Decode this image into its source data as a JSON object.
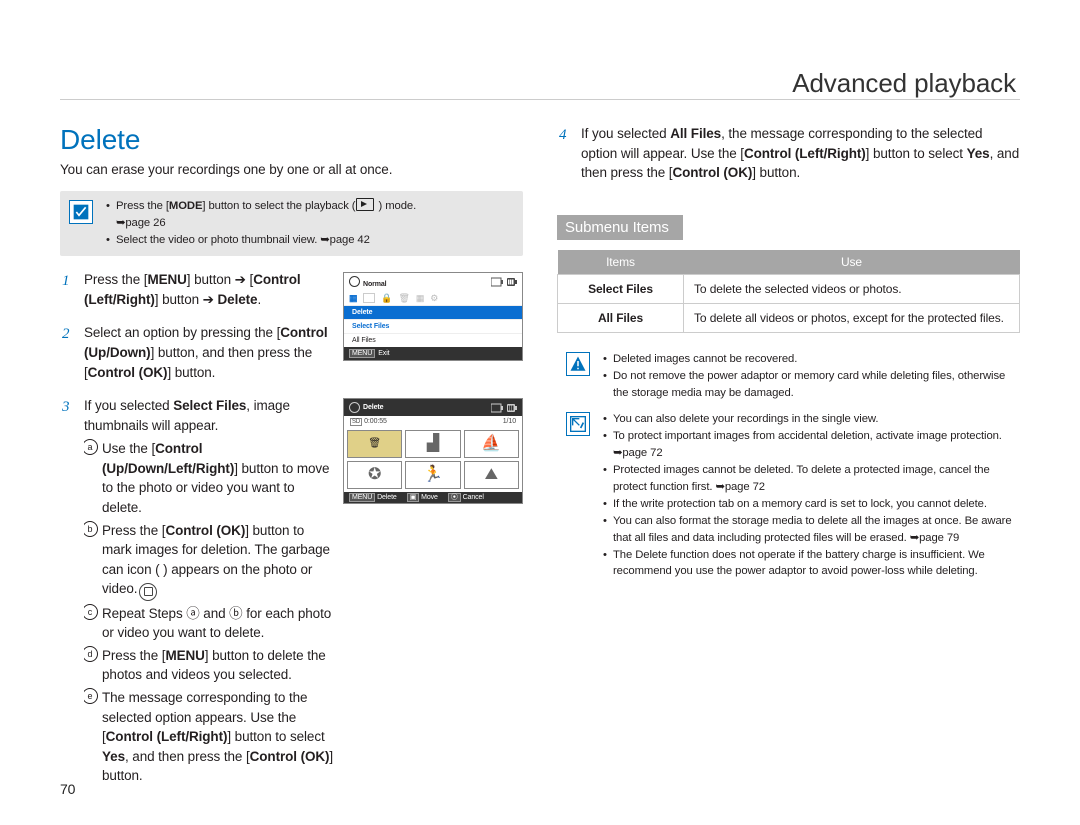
{
  "pageNumber": "70",
  "header": {
    "title": "Advanced playback"
  },
  "section": {
    "heading": "Delete",
    "intro": "You can erase your recordings one by one or all at once."
  },
  "modeBox": {
    "line1a": "Press the [",
    "line1b": "MODE",
    "line1c": "] button to select the playback (",
    "line1d": " ) mode. ",
    "line1ref": "➥page 26",
    "line2": "Select the video or photo thumbnail view. ➥page 42"
  },
  "steps": [
    {
      "parts": [
        "Press the [",
        "MENU",
        "] button ➔ [",
        "Control (Left/Right)",
        "] button ➔ ",
        "Delete",
        "."
      ]
    },
    {
      "parts": [
        "Select an option by pressing the [",
        "Control (Up/Down)",
        "] button, and then press the [",
        "Control (OK)",
        "] button."
      ]
    },
    {
      "parts": [
        "If you selected ",
        "Select Files",
        ", image thumbnails will appear."
      ],
      "sub": [
        {
          "parts": [
            "Use the [",
            "Control (Up/Down/Left/Right)",
            "] button to move to the photo or video you want to delete."
          ]
        },
        {
          "parts": [
            "Press the [",
            "Control (OK)",
            "] button to mark images for deletion. The garbage can icon (   ) appears on the photo or video."
          ]
        },
        {
          "parts": [
            "Repeat Steps ⓐ and ⓑ for each photo or video you want to delete."
          ]
        },
        {
          "parts": [
            "Press the [",
            "MENU",
            "] button to delete the photos and videos you selected."
          ]
        },
        {
          "parts": [
            "The message corresponding to the selected option appears. Use the [",
            "Control (Left/Right)",
            "] button to select ",
            "Yes",
            ", and then press the [",
            "Control (OK)",
            "] button."
          ]
        }
      ]
    },
    {
      "parts": [
        "If you selected ",
        "All Files",
        ", the message corresponding to the selected option will appear. Use the [",
        "Control (Left/Right)",
        "] button to select ",
        "Yes",
        ", and then press the [",
        "Control (OK)",
        "] button."
      ]
    }
  ],
  "figure1": {
    "topLabel": "Normal",
    "menuLabel1": "Delete",
    "menuItems": [
      "Select Files",
      "All Files"
    ],
    "footerBtn": "MENU",
    "footerLabel": "Exit"
  },
  "figure2": {
    "topLabel": "Delete",
    "time": "0:00:55",
    "count": "1/10",
    "footer": [
      {
        "btn": "MENU",
        "label": "Delete"
      },
      {
        "btn": "▣",
        "label": "Move"
      },
      {
        "btn": "⦿",
        "label": "Cancel"
      }
    ]
  },
  "submenu": {
    "heading": "Submenu Items",
    "headers": {
      "col1": "Items",
      "col2": "Use"
    },
    "rows": [
      {
        "name": "Select Files",
        "desc": "To delete the selected videos or photos."
      },
      {
        "name": "All Files",
        "desc": "To delete all videos or photos, except for the protected files."
      }
    ]
  },
  "warnBox": [
    "Deleted images cannot be recovered.",
    "Do not remove the power adaptor or memory card while deleting files, otherwise the storage media may be damaged."
  ],
  "noteBox": [
    "You can also delete your recordings in the single view.",
    "To protect important images from accidental deletion, activate image protection. ➥page 72",
    "Protected images cannot be deleted. To delete a protected image, cancel the protect function first. ➥page 72",
    "If the write protection tab on a memory card is set to lock, you cannot delete.",
    "You can also format the storage media to delete all the images at once. Be aware that all files and data including protected files will be erased. ➥page 79",
    "The Delete function does not operate if the battery charge is insufficient. We recommend you use the power adaptor to avoid power-loss while deleting."
  ]
}
